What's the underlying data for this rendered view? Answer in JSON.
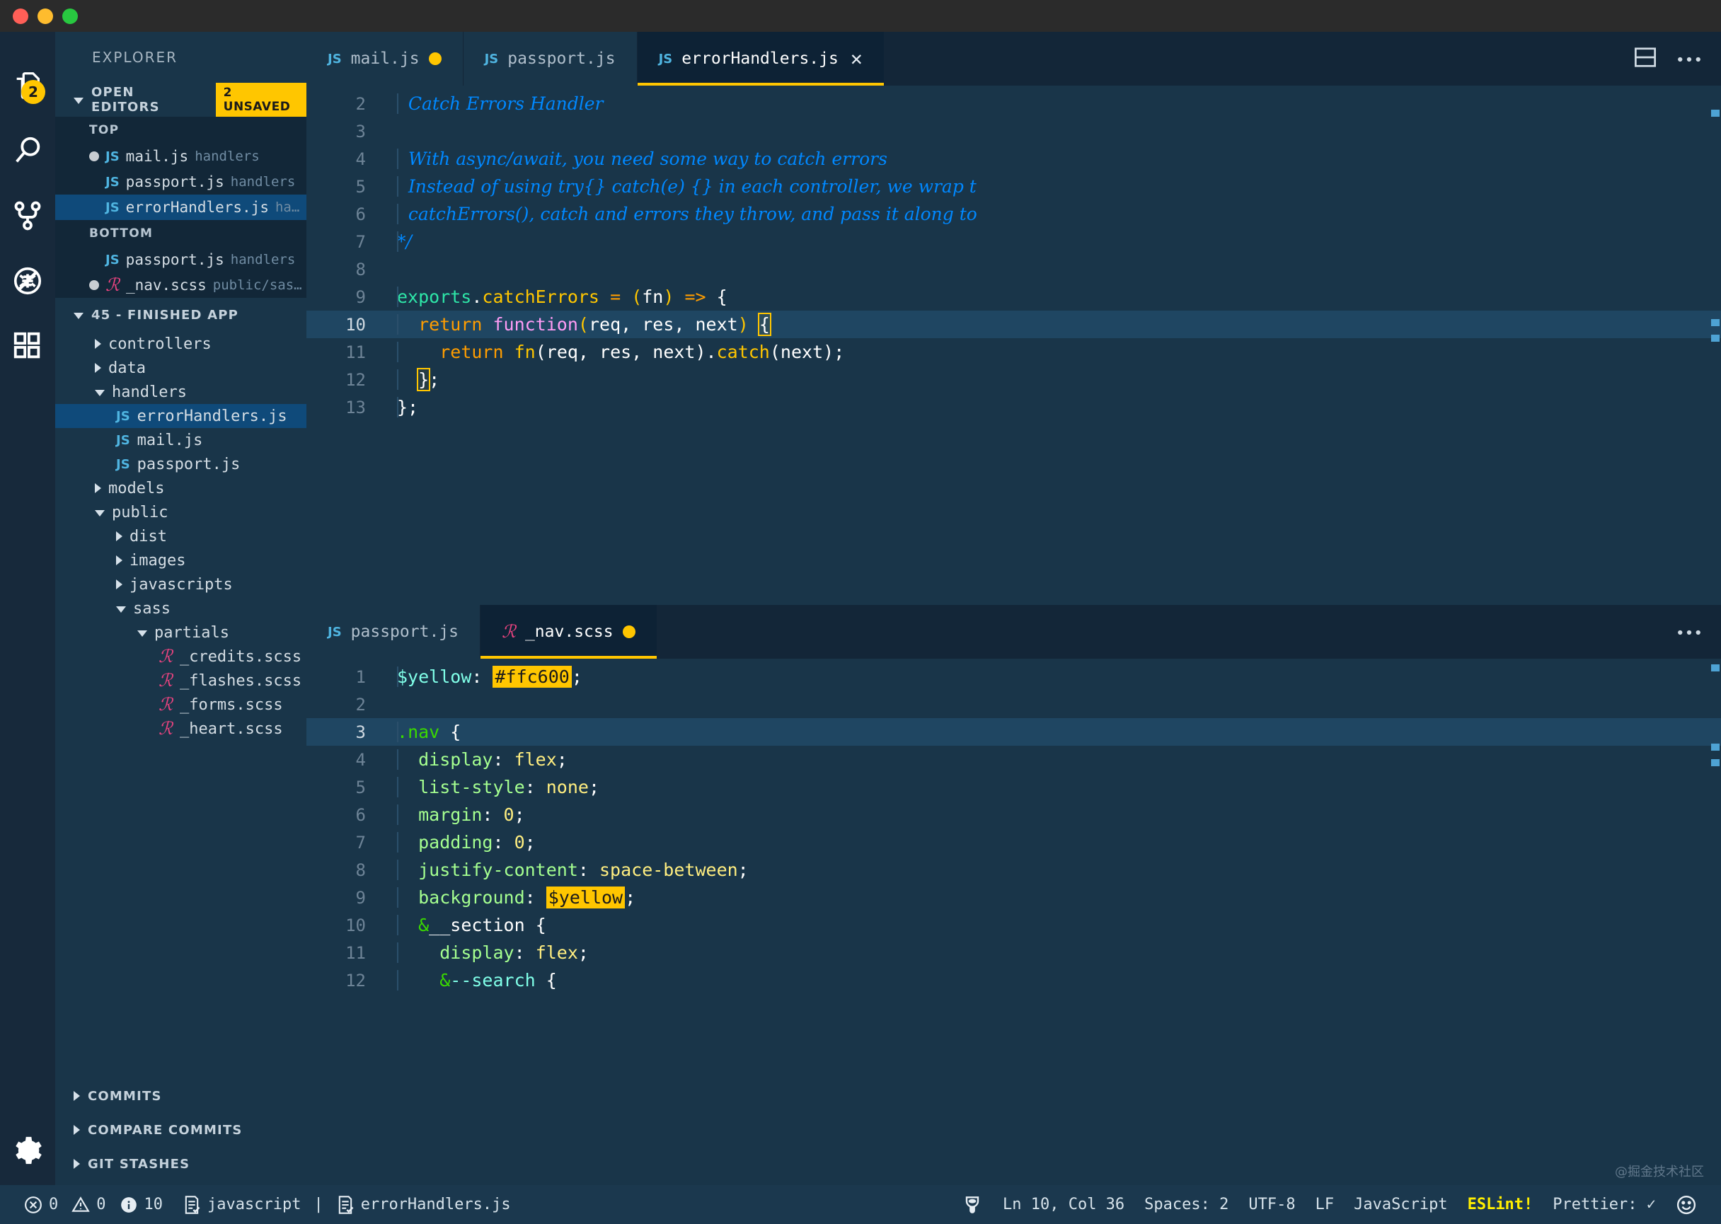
{
  "window": {
    "traffic_lights": [
      "close",
      "minimize",
      "zoom"
    ]
  },
  "activitybar": {
    "items": [
      {
        "name": "explorer",
        "icon": "files-icon",
        "badge": "2"
      },
      {
        "name": "search",
        "icon": "search-icon",
        "badge": ""
      },
      {
        "name": "source-control",
        "icon": "source-control-icon",
        "badge": ""
      },
      {
        "name": "debug",
        "icon": "debug-disabled-icon",
        "badge": ""
      },
      {
        "name": "extensions",
        "icon": "extensions-icon",
        "badge": ""
      }
    ],
    "settings": {
      "name": "manage",
      "icon": "gear-icon"
    }
  },
  "sidebar": {
    "title": "EXPLORER",
    "open_editors": {
      "label": "OPEN EDITORS",
      "badge": "2 UNSAVED",
      "groups": [
        {
          "label": "TOP",
          "files": [
            {
              "dirty": true,
              "icon": "js-icon",
              "name": "mail.js",
              "path": "handlers",
              "selected": false
            },
            {
              "dirty": false,
              "icon": "js-icon",
              "name": "passport.js",
              "path": "handlers",
              "selected": false
            },
            {
              "dirty": false,
              "icon": "js-icon",
              "name": "errorHandlers.js",
              "path": "handler…",
              "selected": true
            }
          ]
        },
        {
          "label": "BOTTOM",
          "files": [
            {
              "dirty": false,
              "icon": "js-icon",
              "name": "passport.js",
              "path": "handlers",
              "selected": false
            },
            {
              "dirty": true,
              "icon": "scss-icon",
              "name": "_nav.scss",
              "path": "public/sass/pa…",
              "selected": false
            }
          ]
        }
      ]
    },
    "project": {
      "label": "45 - FINISHED APP",
      "tree": [
        {
          "depth": 1,
          "kind": "folder",
          "state": "collapsed",
          "label": "controllers",
          "selected": false
        },
        {
          "depth": 1,
          "kind": "folder",
          "state": "collapsed",
          "label": "data",
          "selected": false
        },
        {
          "depth": 1,
          "kind": "folder",
          "state": "expanded",
          "label": "handlers",
          "selected": false
        },
        {
          "depth": 2,
          "kind": "js",
          "state": "",
          "label": "errorHandlers.js",
          "selected": true
        },
        {
          "depth": 2,
          "kind": "js",
          "state": "",
          "label": "mail.js",
          "selected": false
        },
        {
          "depth": 2,
          "kind": "js",
          "state": "",
          "label": "passport.js",
          "selected": false
        },
        {
          "depth": 1,
          "kind": "folder",
          "state": "collapsed",
          "label": "models",
          "selected": false
        },
        {
          "depth": 1,
          "kind": "folder",
          "state": "expanded",
          "label": "public",
          "selected": false
        },
        {
          "depth": 2,
          "kind": "folder",
          "state": "collapsed",
          "label": "dist",
          "selected": false
        },
        {
          "depth": 2,
          "kind": "folder",
          "state": "collapsed",
          "label": "images",
          "selected": false
        },
        {
          "depth": 2,
          "kind": "folder",
          "state": "collapsed",
          "label": "javascripts",
          "selected": false
        },
        {
          "depth": 2,
          "kind": "folder",
          "state": "expanded",
          "label": "sass",
          "selected": false
        },
        {
          "depth": 3,
          "kind": "folder",
          "state": "expanded",
          "label": "partials",
          "selected": false
        },
        {
          "depth": 4,
          "kind": "scss",
          "state": "",
          "label": "_credits.scss",
          "selected": false
        },
        {
          "depth": 4,
          "kind": "scss",
          "state": "",
          "label": "_flashes.scss",
          "selected": false
        },
        {
          "depth": 4,
          "kind": "scss",
          "state": "",
          "label": "_forms.scss",
          "selected": false
        },
        {
          "depth": 4,
          "kind": "scss",
          "state": "",
          "label": "_heart.scss",
          "selected": false
        }
      ]
    },
    "bottom_sections": [
      {
        "label": "COMMITS"
      },
      {
        "label": "COMPARE COMMITS"
      },
      {
        "label": "GIT STASHES"
      }
    ]
  },
  "editor_top": {
    "tabs": [
      {
        "icon": "js-icon",
        "label": "mail.js",
        "dirty": true,
        "active": false,
        "closable": false
      },
      {
        "icon": "js-icon",
        "label": "passport.js",
        "dirty": false,
        "active": false,
        "closable": false
      },
      {
        "icon": "js-icon",
        "label": "errorHandlers.js",
        "dirty": false,
        "active": true,
        "closable": true
      }
    ],
    "actions": [
      {
        "name": "split-editor-icon"
      },
      {
        "name": "more-actions-icon"
      }
    ],
    "lines": [
      {
        "n": "2",
        "highlight": false,
        "tokens": [
          {
            "t": "  Catch Errors Handler",
            "c": "c-comment"
          }
        ]
      },
      {
        "n": "3",
        "highlight": false,
        "tokens": [
          {
            "t": "",
            "c": "c-plain"
          }
        ]
      },
      {
        "n": "4",
        "highlight": false,
        "tokens": [
          {
            "t": "  With async/await, you need some way to catch errors",
            "c": "c-comment"
          }
        ]
      },
      {
        "n": "5",
        "highlight": false,
        "tokens": [
          {
            "t": "  Instead of using try{} catch(e) {} in each controller, we wrap t",
            "c": "c-comment"
          }
        ]
      },
      {
        "n": "6",
        "highlight": false,
        "tokens": [
          {
            "t": "  catchErrors(), catch and errors they throw, and pass it along to",
            "c": "c-comment"
          }
        ]
      },
      {
        "n": "7",
        "highlight": false,
        "tokens": [
          {
            "t": "*/",
            "c": "c-comment"
          }
        ]
      },
      {
        "n": "8",
        "highlight": false,
        "tokens": [
          {
            "t": "",
            "c": "c-plain"
          }
        ]
      },
      {
        "n": "9",
        "highlight": false,
        "tokens": [
          {
            "t": "exports",
            "c": "c-green"
          },
          {
            "t": ".",
            "c": "c-white"
          },
          {
            "t": "catchErrors",
            "c": "c-yellow"
          },
          {
            "t": " ",
            "c": "c-plain"
          },
          {
            "t": "=",
            "c": "c-orange"
          },
          {
            "t": " ",
            "c": "c-plain"
          },
          {
            "t": "(",
            "c": "c-yellow"
          },
          {
            "t": "fn",
            "c": "c-white"
          },
          {
            "t": ")",
            "c": "c-yellow"
          },
          {
            "t": " ",
            "c": "c-plain"
          },
          {
            "t": "=>",
            "c": "c-orange"
          },
          {
            "t": " ",
            "c": "c-plain"
          },
          {
            "t": "{",
            "c": "c-white"
          }
        ]
      },
      {
        "n": "10",
        "highlight": true,
        "tokens": [
          {
            "t": "  ",
            "c": "c-plain"
          },
          {
            "t": "return",
            "c": "c-orange"
          },
          {
            "t": " ",
            "c": "c-plain"
          },
          {
            "t": "function",
            "c": "c-pink"
          },
          {
            "t": "(",
            "c": "c-yellow"
          },
          {
            "t": "req, res, next",
            "c": "c-white"
          },
          {
            "t": ")",
            "c": "c-yellow"
          },
          {
            "t": " ",
            "c": "c-plain"
          },
          {
            "t": "{",
            "c": "c-white",
            "box": true
          }
        ]
      },
      {
        "n": "11",
        "highlight": false,
        "tokens": [
          {
            "t": "    ",
            "c": "c-plain"
          },
          {
            "t": "return",
            "c": "c-orange"
          },
          {
            "t": " ",
            "c": "c-plain"
          },
          {
            "t": "fn",
            "c": "c-yellow"
          },
          {
            "t": "(",
            "c": "c-white"
          },
          {
            "t": "req, res, next",
            "c": "c-white"
          },
          {
            "t": ").",
            "c": "c-white"
          },
          {
            "t": "catch",
            "c": "c-yellow"
          },
          {
            "t": "(",
            "c": "c-white"
          },
          {
            "t": "next",
            "c": "c-white"
          },
          {
            "t": ");",
            "c": "c-white"
          }
        ]
      },
      {
        "n": "12",
        "highlight": false,
        "tokens": [
          {
            "t": "  ",
            "c": "c-plain"
          },
          {
            "t": "}",
            "c": "c-white",
            "box": true
          },
          {
            "t": ";",
            "c": "c-white"
          }
        ]
      },
      {
        "n": "13",
        "highlight": false,
        "tokens": [
          {
            "t": "};",
            "c": "c-white"
          }
        ]
      }
    ]
  },
  "editor_bottom": {
    "tabs": [
      {
        "icon": "js-icon",
        "label": "passport.js",
        "dirty": false,
        "active": false,
        "closable": false
      },
      {
        "icon": "scss-icon",
        "label": "_nav.scss",
        "dirty": true,
        "active": true,
        "closable": false
      }
    ],
    "actions": [
      {
        "name": "more-actions-icon"
      }
    ],
    "lines": [
      {
        "n": "1",
        "highlight": false,
        "tokens": [
          {
            "t": "$yellow",
            "c": "c-cyan"
          },
          {
            "t": ": ",
            "c": "c-white"
          },
          {
            "t": "#ffc600",
            "c": "c-plain",
            "chip": true
          },
          {
            "t": ";",
            "c": "c-white"
          }
        ]
      },
      {
        "n": "2",
        "highlight": false,
        "tokens": [
          {
            "t": "",
            "c": "c-plain"
          }
        ]
      },
      {
        "n": "3",
        "highlight": true,
        "tokens": [
          {
            "t": ".",
            "c": "c-brightgreen"
          },
          {
            "t": "nav",
            "c": "c-brightgreen"
          },
          {
            "t": " ",
            "c": "c-plain"
          },
          {
            "t": "{",
            "c": "c-white"
          }
        ]
      },
      {
        "n": "4",
        "highlight": false,
        "tokens": [
          {
            "t": "  ",
            "c": "c-plain"
          },
          {
            "t": "display",
            "c": "c-lgreen"
          },
          {
            "t": ": ",
            "c": "c-white"
          },
          {
            "t": "flex",
            "c": "c-lyellow"
          },
          {
            "t": ";",
            "c": "c-white"
          }
        ]
      },
      {
        "n": "5",
        "highlight": false,
        "tokens": [
          {
            "t": "  ",
            "c": "c-plain"
          },
          {
            "t": "list-style",
            "c": "c-lgreen"
          },
          {
            "t": ": ",
            "c": "c-white"
          },
          {
            "t": "none",
            "c": "c-lyellow"
          },
          {
            "t": ";",
            "c": "c-white"
          }
        ]
      },
      {
        "n": "6",
        "highlight": false,
        "tokens": [
          {
            "t": "  ",
            "c": "c-plain"
          },
          {
            "t": "margin",
            "c": "c-lgreen"
          },
          {
            "t": ": ",
            "c": "c-white"
          },
          {
            "t": "0",
            "c": "c-lyellow"
          },
          {
            "t": ";",
            "c": "c-white"
          }
        ]
      },
      {
        "n": "7",
        "highlight": false,
        "tokens": [
          {
            "t": "  ",
            "c": "c-plain"
          },
          {
            "t": "padding",
            "c": "c-lgreen"
          },
          {
            "t": ": ",
            "c": "c-white"
          },
          {
            "t": "0",
            "c": "c-lyellow"
          },
          {
            "t": ";",
            "c": "c-white"
          }
        ]
      },
      {
        "n": "8",
        "highlight": false,
        "tokens": [
          {
            "t": "  ",
            "c": "c-plain"
          },
          {
            "t": "justify-content",
            "c": "c-lgreen"
          },
          {
            "t": ": ",
            "c": "c-white"
          },
          {
            "t": "space-between",
            "c": "c-lyellow"
          },
          {
            "t": ";",
            "c": "c-white"
          }
        ]
      },
      {
        "n": "9",
        "highlight": false,
        "tokens": [
          {
            "t": "  ",
            "c": "c-plain"
          },
          {
            "t": "background",
            "c": "c-lgreen"
          },
          {
            "t": ": ",
            "c": "c-white"
          },
          {
            "t": "$yellow",
            "c": "c-plain",
            "chip": true
          },
          {
            "t": ";",
            "c": "c-white"
          }
        ]
      },
      {
        "n": "10",
        "highlight": false,
        "tokens": [
          {
            "t": "  ",
            "c": "c-plain"
          },
          {
            "t": "&",
            "c": "c-brightgreen"
          },
          {
            "t": "__section",
            "c": "c-white"
          },
          {
            "t": " ",
            "c": "c-plain"
          },
          {
            "t": "{",
            "c": "c-white"
          }
        ]
      },
      {
        "n": "11",
        "highlight": false,
        "tokens": [
          {
            "t": "    ",
            "c": "c-plain"
          },
          {
            "t": "display",
            "c": "c-lgreen"
          },
          {
            "t": ": ",
            "c": "c-white"
          },
          {
            "t": "flex",
            "c": "c-lyellow"
          },
          {
            "t": ";",
            "c": "c-white"
          }
        ]
      },
      {
        "n": "12",
        "highlight": false,
        "tokens": [
          {
            "t": "    ",
            "c": "c-plain"
          },
          {
            "t": "&",
            "c": "c-brightgreen"
          },
          {
            "t": "--search",
            "c": "c-cyan"
          },
          {
            "t": " ",
            "c": "c-plain"
          },
          {
            "t": "{",
            "c": "c-white"
          }
        ]
      }
    ]
  },
  "statusbar": {
    "left": [
      {
        "name": "errors-warnings",
        "icon": "error-icon",
        "text": "0"
      },
      {
        "name": "warnings",
        "icon": "warning-icon",
        "text": "0"
      },
      {
        "name": "infos",
        "icon": "info-icon",
        "text": "10"
      },
      {
        "name": "language-mode-left",
        "icon": "checklist-icon",
        "text": "javascript"
      },
      {
        "name": "separator",
        "icon": "",
        "text": "|"
      },
      {
        "name": "active-file",
        "icon": "checklist-icon",
        "text": "errorHandlers.js"
      }
    ],
    "right": [
      {
        "name": "color-theme",
        "icon": "paint-bucket-icon",
        "text": ""
      },
      {
        "name": "cursor-position",
        "icon": "",
        "text": "Ln 10, Col 36"
      },
      {
        "name": "indentation",
        "icon": "",
        "text": "Spaces: 2"
      },
      {
        "name": "encoding",
        "icon": "",
        "text": "UTF-8"
      },
      {
        "name": "eol",
        "icon": "",
        "text": "LF"
      },
      {
        "name": "language-mode",
        "icon": "",
        "text": "JavaScript"
      },
      {
        "name": "eslint-status",
        "icon": "",
        "text": "ESLint!"
      },
      {
        "name": "prettier-status",
        "icon": "",
        "text": "Prettier: ✓"
      },
      {
        "name": "feedback",
        "icon": "smiley-icon",
        "text": ""
      }
    ]
  },
  "watermark": {
    "text": "@掘金技术社区"
  },
  "colors": {
    "accent": "#ffc600",
    "sidebar_bg": "#193549",
    "editor_bg": "#193549",
    "selection": "#0f4a7a",
    "scss_pink": "#e8437f",
    "js_blue": "#4fb4e0"
  }
}
